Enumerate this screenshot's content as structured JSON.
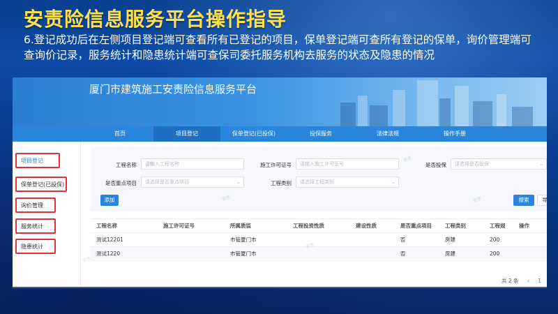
{
  "slide": {
    "title": "安责险信息服务平台操作指导",
    "description": "6.登记成功后在左侧项目登记端可查看所有已登记的项目，保单登记端可查所有登记的保单，询价管理端可查询价记录，服务统计和隐患统计端可查保司委托服务机构去服务的状态及隐患的情况"
  },
  "app": {
    "title": "厦门市建筑施工安责险信息服务平台",
    "watermark": "安责"
  },
  "nav": {
    "items": [
      "首页",
      "项目登记",
      "保单登记(已投保)",
      "投保服务",
      "法律法规",
      "操作手册"
    ],
    "active_index": 1
  },
  "sidebar": {
    "items": [
      "项目登记",
      "保单登记(已投保)",
      "询价管理",
      "服务统计",
      "隐患统计"
    ]
  },
  "filters": {
    "project_name_label": "工程名称",
    "project_name_placeholder": "请输入工程名称",
    "permit_label": "施工许可证号",
    "permit_placeholder": "请输入施工许可证号",
    "insured_label": "是否投保",
    "insured_placeholder": "请选择是否投保",
    "key_project_label": "是否重点项目",
    "key_project_placeholder": "请选择是否重点项目",
    "category_label": "工程类别",
    "category_placeholder": "请选择工程类别"
  },
  "buttons": {
    "add": "添加",
    "search": "搜索",
    "export": "导出"
  },
  "table": {
    "columns": [
      "工程名称",
      "施工许可证号",
      "所属质监",
      "工程投资性质",
      "建设性质",
      "是否重点项目",
      "工程类别",
      "工程规",
      "操作"
    ],
    "rows": [
      [
        "测试12201",
        "",
        "市管厦门市",
        "",
        "",
        "否",
        "房建",
        "200",
        ""
      ],
      [
        "测试1220",
        "",
        "市管厦门市",
        "",
        "",
        "否",
        "房建",
        "200",
        ""
      ]
    ]
  },
  "pagination": {
    "total_text": "共 2 条",
    "prev": "‹",
    "page": "1"
  }
}
